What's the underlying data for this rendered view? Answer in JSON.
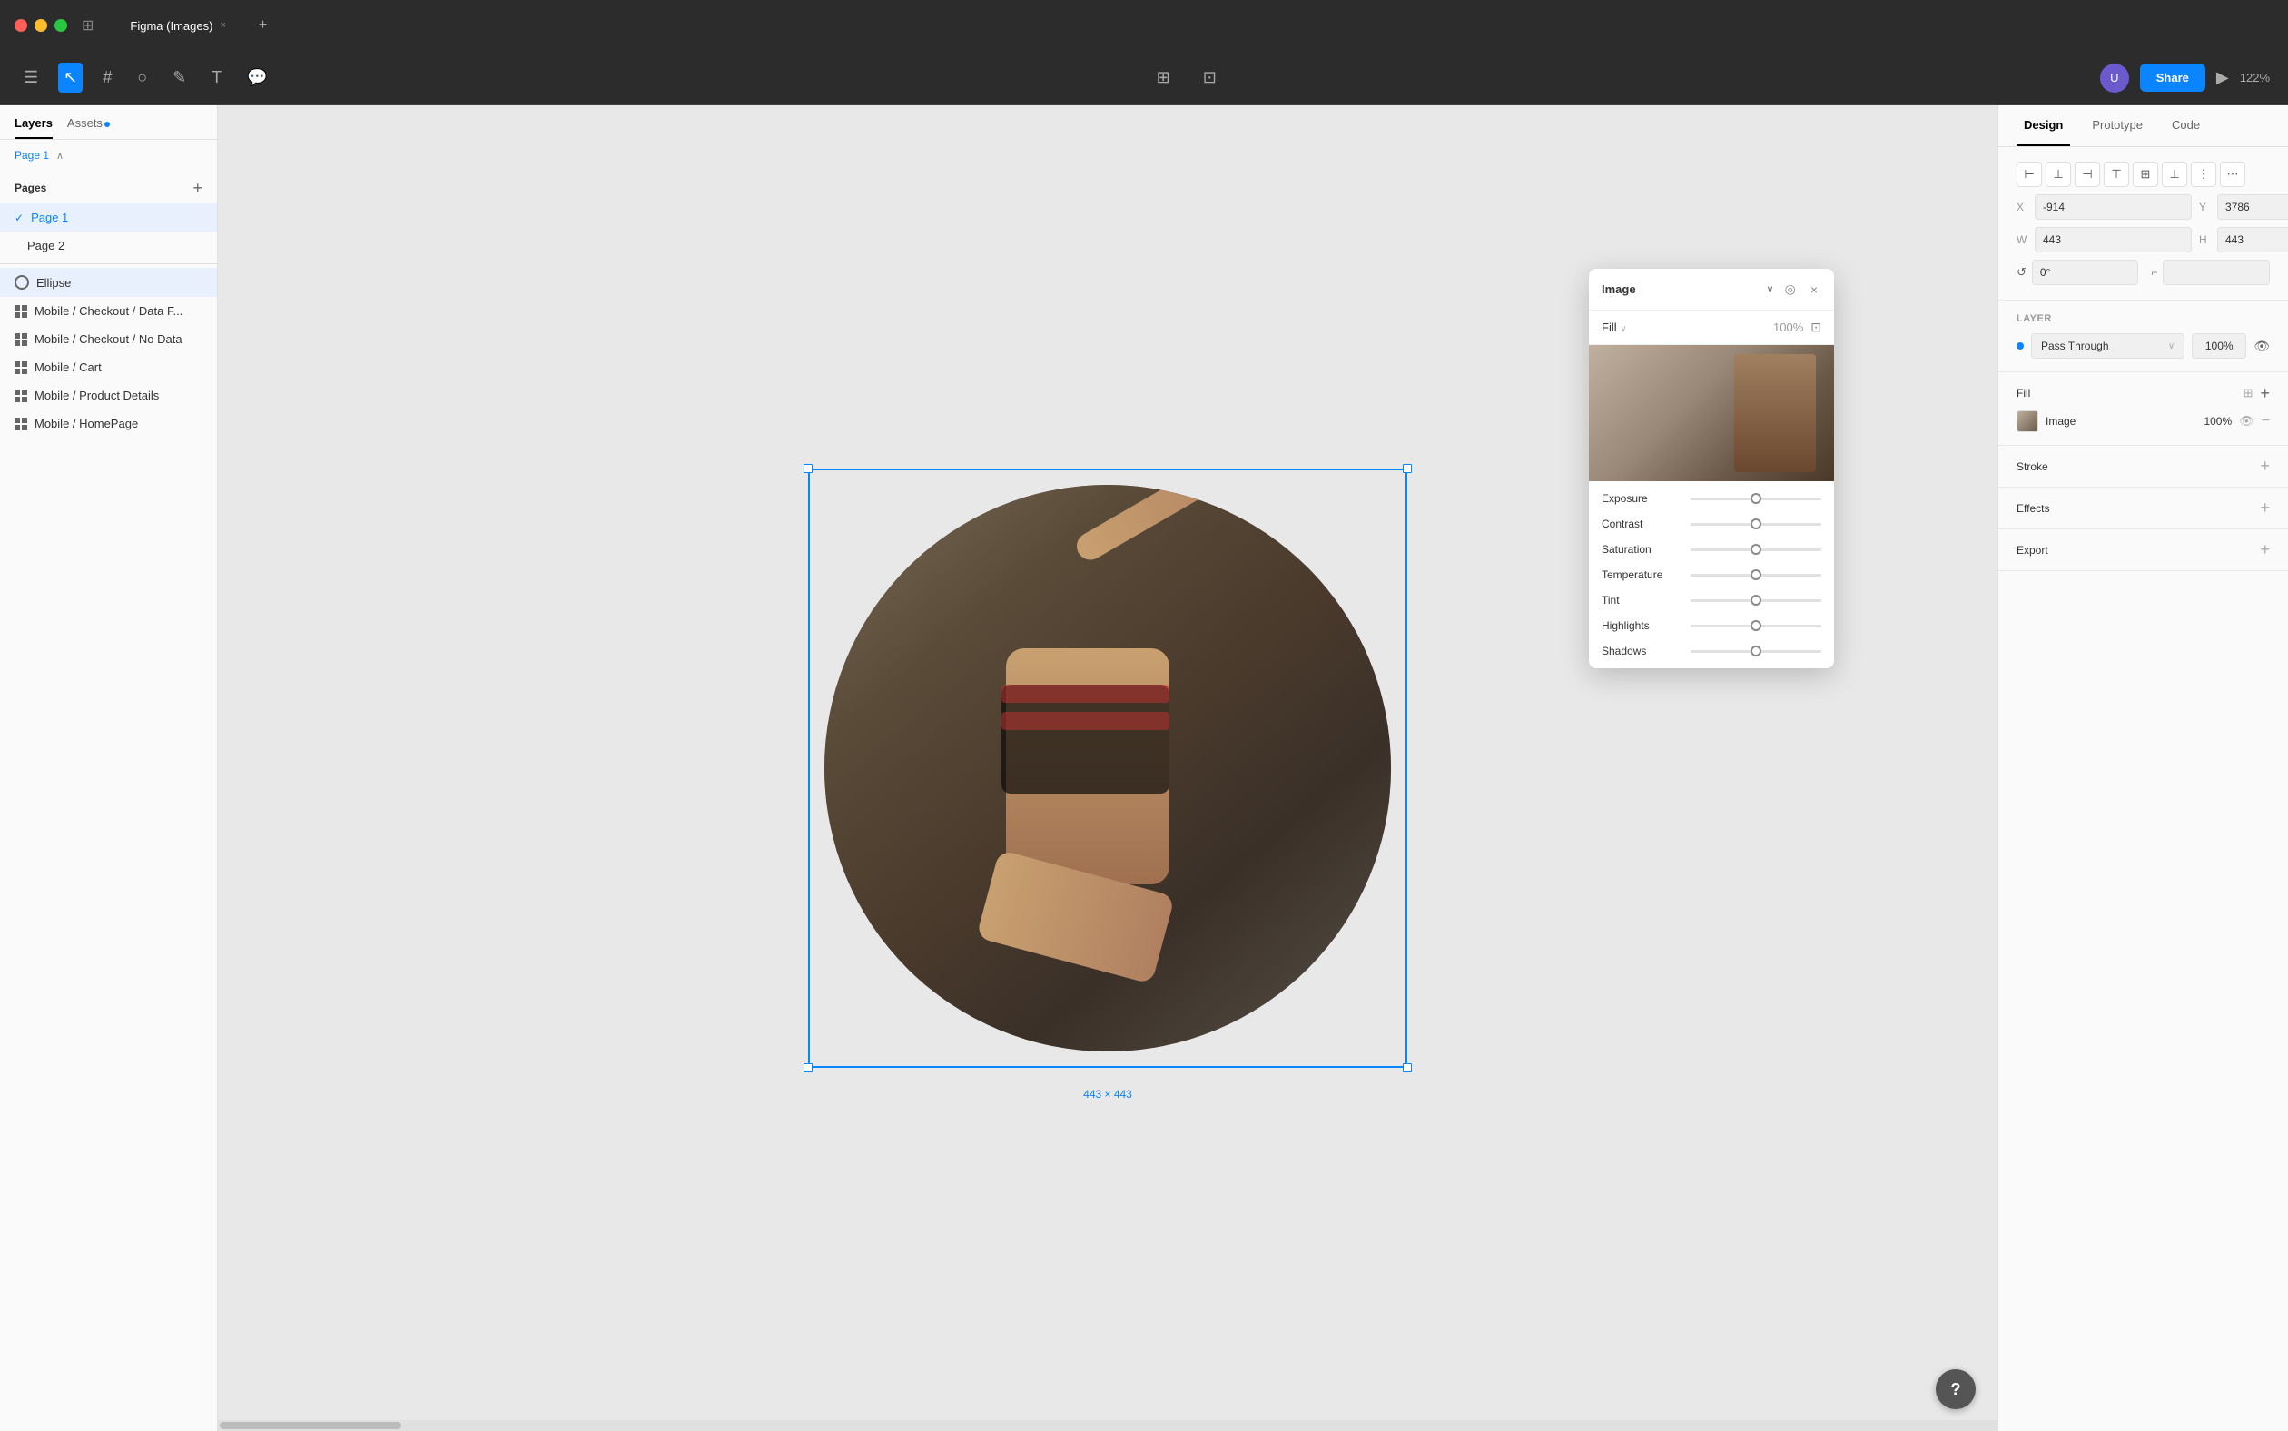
{
  "titlebar": {
    "tab_label": "Figma (Images)",
    "tab_close": "×",
    "tab_new": "+"
  },
  "toolbar": {
    "menu_icon": "☰",
    "select_icon": "↖",
    "frame_icon": "#",
    "shape_icon": "○",
    "pen_icon": "✎",
    "text_icon": "T",
    "comment_icon": "💬",
    "grid_icon": "⊞",
    "crop_icon": "⊡",
    "share_label": "Share",
    "play_icon": "▶",
    "zoom_label": "122%",
    "avatar_initials": "U"
  },
  "left_panel": {
    "tab_layers": "Layers",
    "tab_assets": "Assets",
    "page_label": "Page 1",
    "add_page_icon": "+",
    "pages": [
      {
        "label": "Page 1",
        "active": true
      },
      {
        "label": "Page 2",
        "active": false
      }
    ],
    "layers": [
      {
        "label": "Ellipse",
        "type": "ellipse",
        "active": true
      },
      {
        "label": "Mobile / Checkout / Data F...",
        "type": "grid"
      },
      {
        "label": "Mobile / Checkout / No Data",
        "type": "grid"
      },
      {
        "label": "Mobile / Cart",
        "type": "grid"
      },
      {
        "label": "Mobile / Product Details",
        "type": "grid"
      },
      {
        "label": "Mobile / HomePage",
        "type": "grid"
      }
    ]
  },
  "canvas": {
    "selection_size": "443 × 443",
    "element_width": 443,
    "element_height": 443
  },
  "image_popup": {
    "title": "Image",
    "fill_label": "Fill",
    "fill_pct": "100%",
    "sliders": [
      {
        "label": "Exposure",
        "position": 50
      },
      {
        "label": "Contrast",
        "position": 50
      },
      {
        "label": "Saturation",
        "position": 50
      },
      {
        "label": "Temperature",
        "position": 50
      },
      {
        "label": "Tint",
        "position": 50
      },
      {
        "label": "Highlights",
        "position": 50
      },
      {
        "label": "Shadows",
        "position": 50
      }
    ]
  },
  "right_panel": {
    "tab_design": "Design",
    "tab_prototype": "Prototype",
    "tab_code": "Code",
    "position": {
      "x_label": "X",
      "x_value": "-914",
      "y_label": "Y",
      "y_value": "3786",
      "w_label": "W",
      "w_value": "443",
      "h_label": "H",
      "h_value": "443",
      "rotation_label": "↺",
      "rotation_value": "0°"
    },
    "layer": {
      "title": "Layer",
      "mode": "Pass Through",
      "opacity": "100%"
    },
    "fill": {
      "title": "Fill",
      "fill_name": "Image",
      "fill_opacity": "100%"
    },
    "stroke": {
      "title": "Stroke"
    },
    "effects": {
      "title": "Effects"
    },
    "export": {
      "title": "Export"
    }
  }
}
